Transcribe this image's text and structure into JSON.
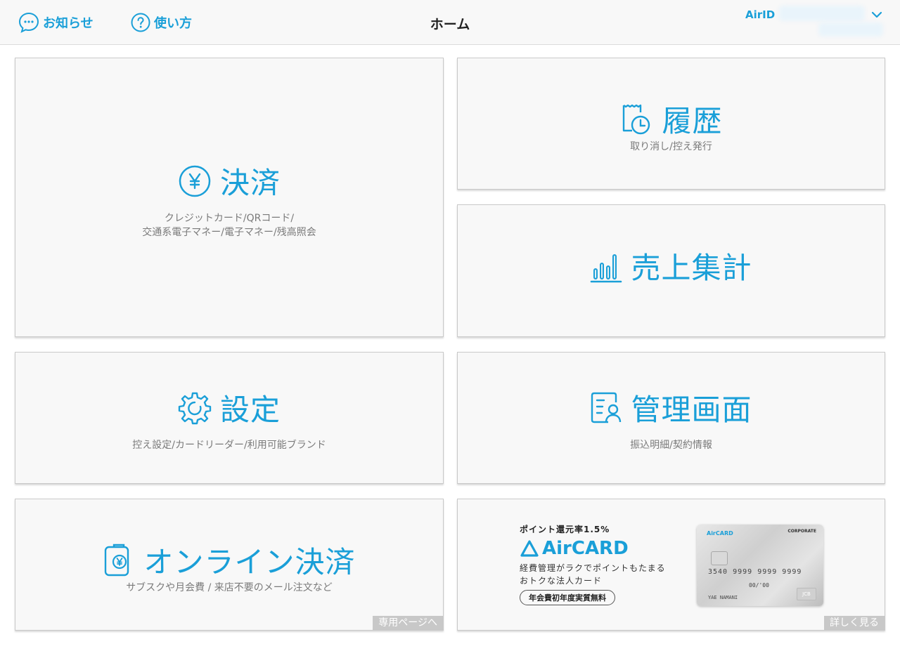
{
  "header": {
    "notice_label": "お知らせ",
    "help_label": "使い方",
    "title": "ホーム",
    "account_label": "AirID"
  },
  "cards": {
    "payment": {
      "title": "決済",
      "sub_line1": "クレジットカード/QRコード/",
      "sub_line2": "交通系電子マネー/電子マネー/残高照会"
    },
    "history": {
      "title": "履歴",
      "sub": "取り消し/控え発行"
    },
    "sales": {
      "title": "売上集計"
    },
    "settings": {
      "title": "設定",
      "sub": "控え設定/カードリーダー/利用可能ブランド"
    },
    "admin": {
      "title": "管理画面",
      "sub": "振込明細/契約情報"
    },
    "online": {
      "title": "オンライン決済",
      "sub": "サブスクや月会費 / 来店不要のメール注文など",
      "corner": "専用ページへ"
    },
    "aircard": {
      "rate": "ポイント還元率1.5%",
      "logo": "AirCARD",
      "desc_line1": "経費管理がラクでポイントもたまる",
      "desc_line2": "おトクな法人カード",
      "badge": "年会費初年度実質無料",
      "corner": "詳しく見る",
      "card_brand": "AirCARD",
      "card_corp": "CORPORATE",
      "card_number": "3540 9999 9999 9999",
      "card_exp": "00/'00",
      "card_name": "YAE NAMANI",
      "card_jcb": "JCB"
    }
  },
  "colors": {
    "accent": "#1a9fd8",
    "card_bg": "#f8f8f8",
    "sub_text": "#7a7a7a"
  },
  "icons": {
    "notice": "speech-bubble-icon",
    "help": "question-circle-icon",
    "account": "chevron-down-icon",
    "payment": "yen-circle-icon",
    "history": "receipt-clock-icon",
    "sales": "bar-chart-icon",
    "settings": "gear-icon",
    "admin": "id-card-person-icon",
    "online": "phone-yen-icon"
  }
}
